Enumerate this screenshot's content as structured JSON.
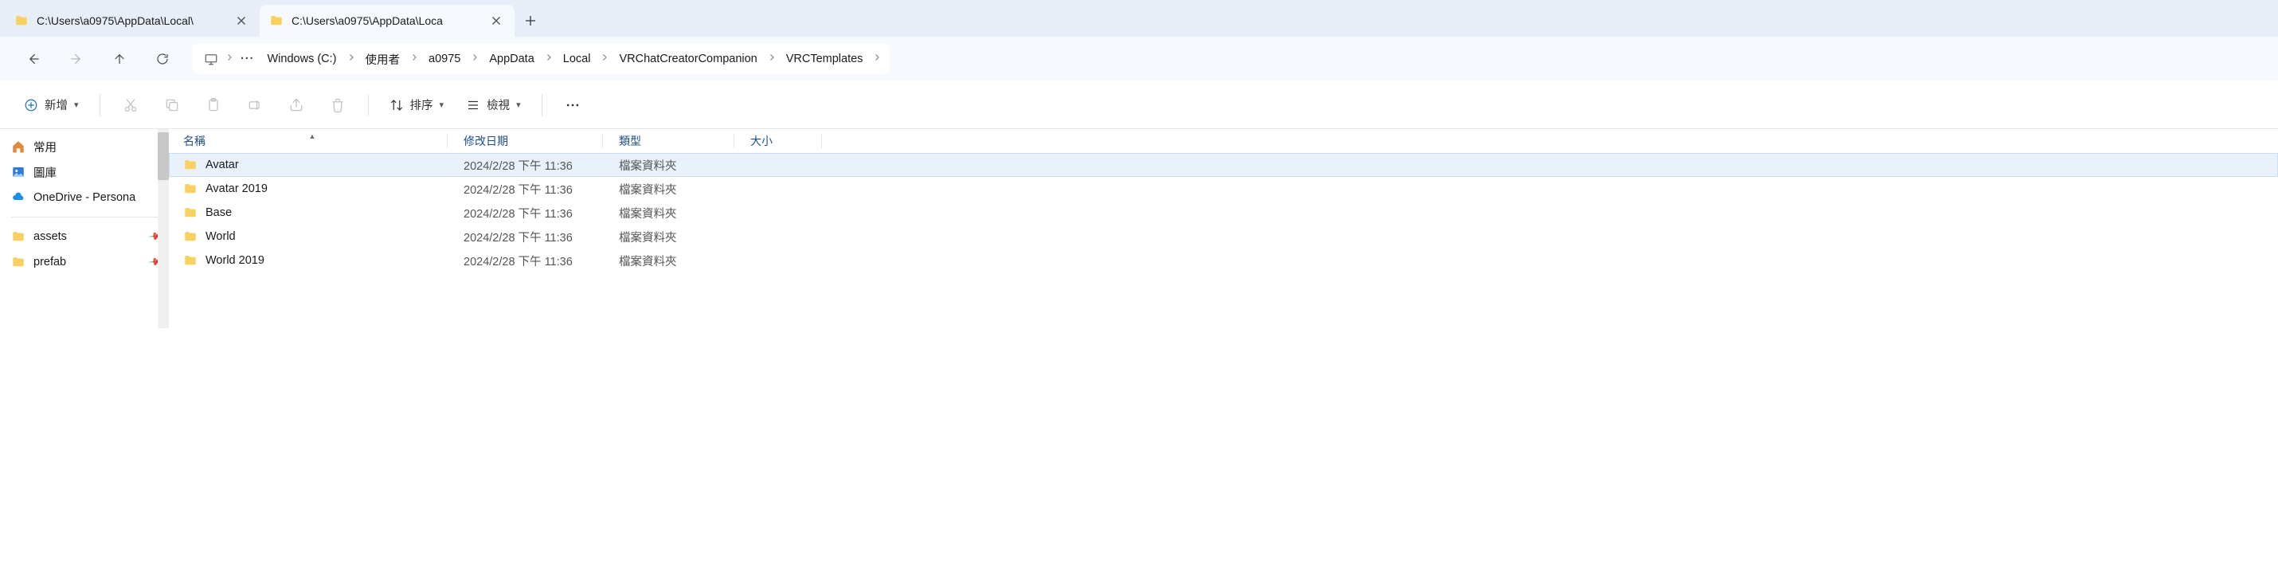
{
  "tabs": [
    {
      "title": "C:\\Users\\a0975\\AppData\\Local\\",
      "active": false
    },
    {
      "title": "C:\\Users\\a0975\\AppData\\Loca",
      "active": true
    }
  ],
  "breadcrumb": [
    "Windows (C:)",
    "使用者",
    "a0975",
    "AppData",
    "Local",
    "VRChatCreatorCompanion",
    "VRCTemplates"
  ],
  "toolbar": {
    "new_label": "新增",
    "sort_label": "排序",
    "view_label": "檢視"
  },
  "sidebar": {
    "top": [
      {
        "icon": "home",
        "label": "常用"
      },
      {
        "icon": "gallery",
        "label": "圖庫"
      },
      {
        "icon": "onedrive",
        "label": "OneDrive - Persona"
      }
    ],
    "quick": [
      {
        "icon": "folder",
        "label": "assets",
        "pinned": true
      },
      {
        "icon": "folder",
        "label": "prefab",
        "pinned": true
      }
    ]
  },
  "columns": {
    "name": "名稱",
    "date": "修改日期",
    "type": "類型",
    "size": "大小"
  },
  "rows": [
    {
      "name": "Avatar",
      "date": "2024/2/28 下午 11:36",
      "type": "檔案資料夾",
      "size": "",
      "selected": true
    },
    {
      "name": "Avatar 2019",
      "date": "2024/2/28 下午 11:36",
      "type": "檔案資料夾",
      "size": "",
      "selected": false
    },
    {
      "name": "Base",
      "date": "2024/2/28 下午 11:36",
      "type": "檔案資料夾",
      "size": "",
      "selected": false
    },
    {
      "name": "World",
      "date": "2024/2/28 下午 11:36",
      "type": "檔案資料夾",
      "size": "",
      "selected": false
    },
    {
      "name": "World 2019",
      "date": "2024/2/28 下午 11:36",
      "type": "檔案資料夾",
      "size": "",
      "selected": false
    }
  ]
}
